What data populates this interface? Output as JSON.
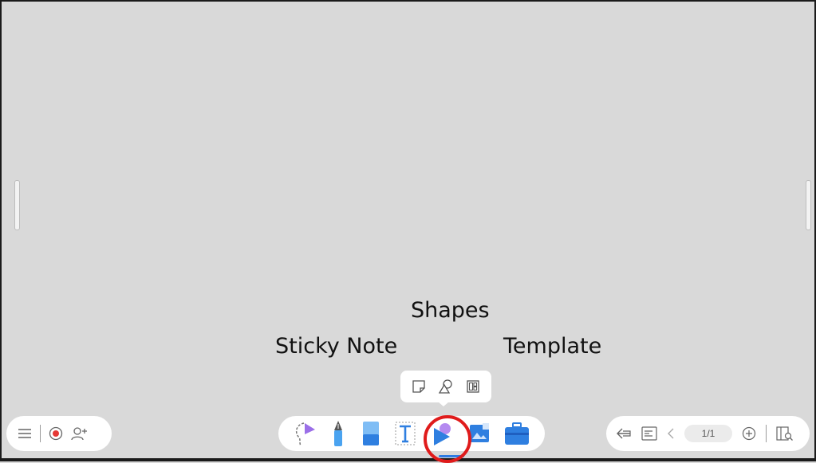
{
  "annotations": {
    "shapes": "Shapes",
    "sticky_note": "Sticky Note",
    "template": "Template"
  },
  "popup": {
    "items": [
      {
        "icon": "sticky-note-icon"
      },
      {
        "icon": "shapes-icon"
      },
      {
        "icon": "template-icon"
      }
    ]
  },
  "left_toolbar": {
    "items": [
      {
        "icon": "menu-icon"
      },
      {
        "icon": "record-icon"
      },
      {
        "icon": "add-user-icon"
      }
    ]
  },
  "main_toolbar": {
    "items": [
      {
        "icon": "lasso-select-icon"
      },
      {
        "icon": "pen-icon"
      },
      {
        "icon": "eraser-icon"
      },
      {
        "icon": "text-icon"
      },
      {
        "icon": "shapes-tool-icon",
        "active": true
      },
      {
        "icon": "image-icon"
      },
      {
        "icon": "toolbox-icon"
      }
    ]
  },
  "right_toolbar": {
    "page_indicator": "1/1",
    "items": [
      {
        "icon": "undo-arrow-icon"
      },
      {
        "icon": "page-settings-icon"
      },
      {
        "icon": "prev-page-icon"
      },
      {
        "icon": "add-page-icon"
      },
      {
        "icon": "page-overview-icon"
      }
    ]
  },
  "colors": {
    "canvas": "#d9d9d9",
    "accent": "#2d7be5",
    "highlight": "#e01b1b",
    "record": "#e53935"
  }
}
